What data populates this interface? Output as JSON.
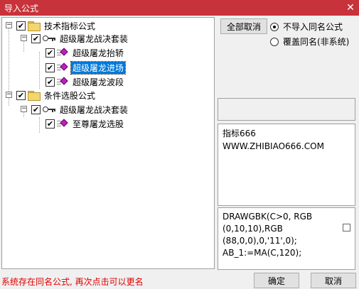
{
  "window": {
    "title": "导入公式",
    "close_glyph": "✕",
    "title_bar_color": "#c8323a"
  },
  "tree": {
    "root1": {
      "label": "技术指标公式",
      "group": {
        "label": "超级屠龙战决套装",
        "items": [
          "超级屠龙抬轿",
          "超级屠龙进场",
          "超级屠龙波段"
        ]
      }
    },
    "root2": {
      "label": "条件选股公式",
      "group": {
        "label": "超级屠龙战决套装",
        "items": [
          "至尊屠龙选股"
        ]
      }
    },
    "selected_item": "超级屠龙进场",
    "check_glyph": "✔",
    "collapse_glyph": "−"
  },
  "options": {
    "cancel_all_label": "全部取消",
    "radio_skip_label": "不导入同名公式",
    "radio_overwrite_label": "覆盖同名(非系统)",
    "selected_radio": "skip"
  },
  "description": {
    "line1": "指标666",
    "line2": "WWW.ZHIBIAO666.COM"
  },
  "code": {
    "lines": [
      "DRAWGBK(C>0, RGB",
      "(0,10,10),RGB",
      "(88,0,0),0,'11',0);",
      "AB_1:=MA(C,120);"
    ]
  },
  "footer": {
    "status": "系统存在同名公式, 再次点击可以更名",
    "status_color": "#e00000",
    "ok_label": "确定",
    "cancel_label": "取消"
  }
}
